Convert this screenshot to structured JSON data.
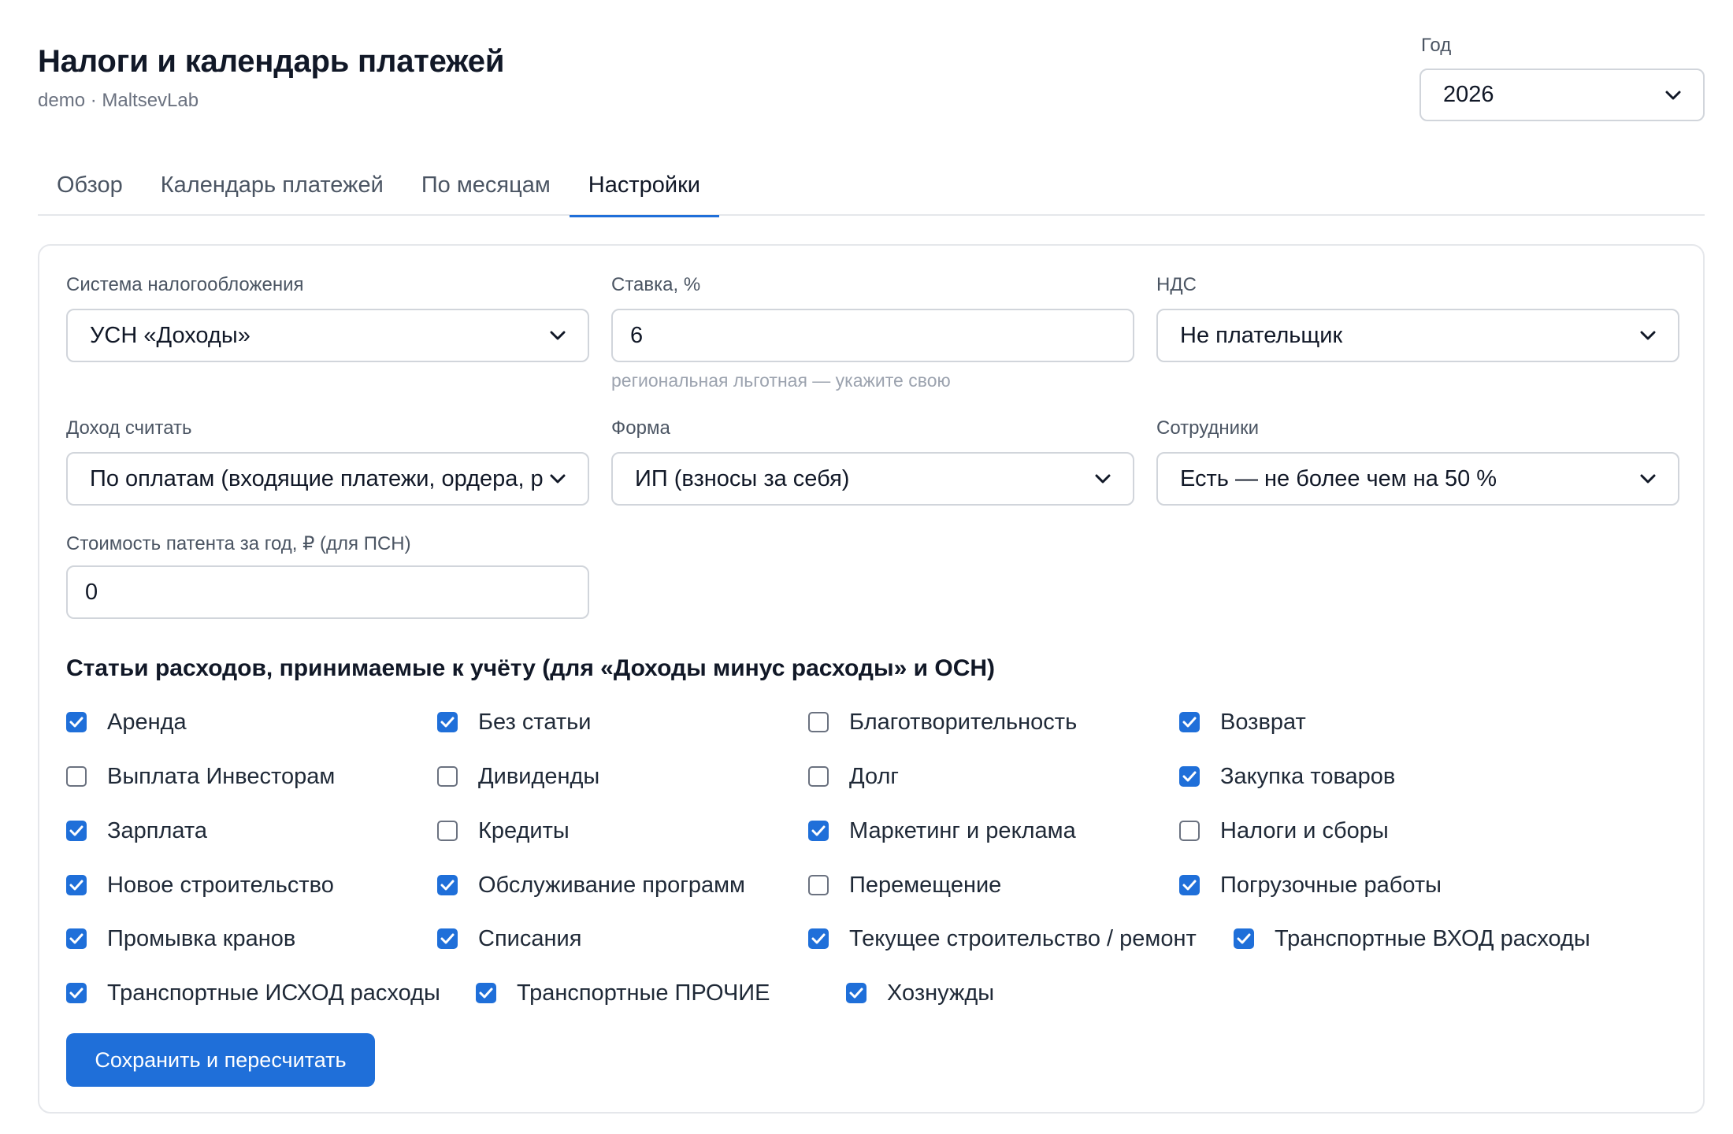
{
  "header": {
    "title": "Налоги и календарь платежей",
    "subtitle": "demo · MaltsevLab",
    "year_label": "Год",
    "year_value": "2026"
  },
  "tabs": [
    {
      "label": "Обзор",
      "active": false
    },
    {
      "label": "Календарь платежей",
      "active": false
    },
    {
      "label": "По месяцам",
      "active": false
    },
    {
      "label": "Настройки",
      "active": true
    }
  ],
  "settings": {
    "tax_system": {
      "label": "Система налогообложения",
      "value": "УСН «Доходы»"
    },
    "rate": {
      "label": "Ставка, %",
      "value": "6",
      "hint": "региональная льготная — укажите свою"
    },
    "vat": {
      "label": "НДС",
      "value": "Не плательщик"
    },
    "income_basis": {
      "label": "Доход считать",
      "value": "По оплатам (входящие платежи, ордера, розница)"
    },
    "form": {
      "label": "Форма",
      "value": "ИП (взносы за себя)"
    },
    "employees": {
      "label": "Сотрудники",
      "value": "Есть — не более чем на 50 %"
    },
    "patent_cost": {
      "label": "Стоимость патента за год, ₽ (для ПСН)",
      "value": "0"
    }
  },
  "expenses": {
    "heading": "Статьи расходов, принимаемые к учёту (для «Доходы минус расходы» и ОСН)",
    "items": [
      {
        "label": "Аренда",
        "checked": true
      },
      {
        "label": "Без статьи",
        "checked": true
      },
      {
        "label": "Благотворительность",
        "checked": false
      },
      {
        "label": "Возврат",
        "checked": true
      },
      {
        "label": "Выплата Инвесторам",
        "checked": false
      },
      {
        "label": "Дивиденды",
        "checked": false
      },
      {
        "label": "Долг",
        "checked": false
      },
      {
        "label": "Закупка товаров",
        "checked": true
      },
      {
        "label": "Зарплата",
        "checked": true
      },
      {
        "label": "Кредиты",
        "checked": false
      },
      {
        "label": "Маркетинг и реклама",
        "checked": true
      },
      {
        "label": "Налоги и сборы",
        "checked": false
      },
      {
        "label": "Новое строительство",
        "checked": true
      },
      {
        "label": "Обслуживание программ",
        "checked": true
      },
      {
        "label": "Перемещение",
        "checked": false
      },
      {
        "label": "Погрузочные работы",
        "checked": true
      },
      {
        "label": "Промывка кранов",
        "checked": true
      },
      {
        "label": "Списания",
        "checked": true
      },
      {
        "label": "Текущее строительство / ремонт",
        "checked": true
      },
      {
        "label": "Транспортные ВХОД расходы",
        "checked": true
      },
      {
        "label": "Транспортные ИСХОД расходы",
        "checked": true
      },
      {
        "label": "Транспортные ПРОЧИЕ",
        "checked": true
      },
      {
        "label": "Хознужды",
        "checked": true
      }
    ]
  },
  "actions": {
    "save_label": "Сохранить и пересчитать"
  },
  "colors": {
    "accent": "#1f6fd9",
    "border": "#d1d5db",
    "muted_text": "#6b7280"
  }
}
